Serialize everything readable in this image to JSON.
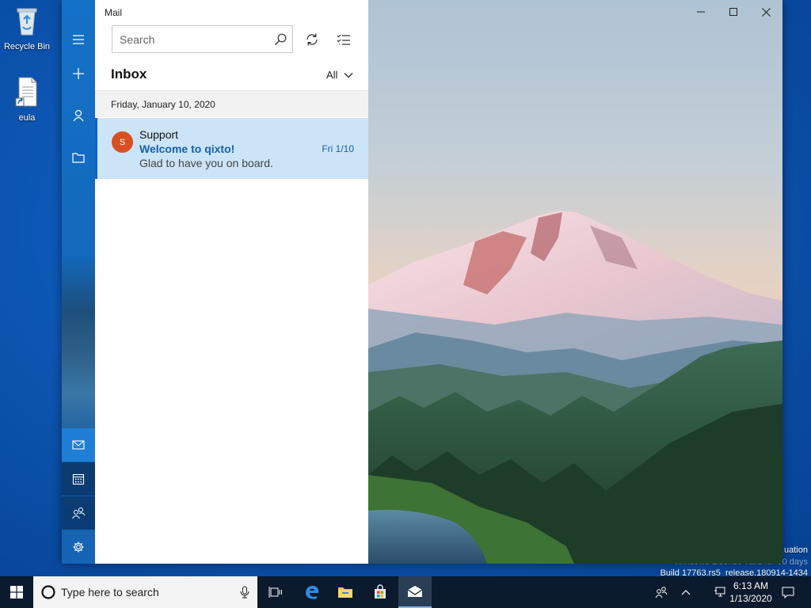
{
  "desktop": {
    "icons": [
      {
        "label": "Recycle Bin",
        "icon": "recycle-bin-icon"
      },
      {
        "label": "eula",
        "icon": "document-shortcut-icon"
      }
    ],
    "watermark": {
      "line1": "uation",
      "line2": "Windows License valid for 90 days",
      "line3": "Build 17763.rs5_release.180914-1434"
    }
  },
  "window": {
    "app_title": "Mail",
    "controls": [
      "minimize-icon",
      "maximize-icon",
      "close-icon"
    ]
  },
  "rail": {
    "top_items": [
      "hamburger-menu-icon",
      "plus-icon",
      "person-icon",
      "folder-icon"
    ],
    "bottom_items": [
      "mail-icon",
      "calendar-icon",
      "people-icon",
      "gear-icon"
    ]
  },
  "list": {
    "search": {
      "placeholder": "Search"
    },
    "folder_title": "Inbox",
    "filter_label": "All",
    "date_group": "Friday, January 10, 2020",
    "messages": [
      {
        "avatar_initial": "S",
        "sender": "Support",
        "subject": "Welcome to qixto!",
        "preview": "Glad to have you on board.",
        "date": "Fri 1/10"
      }
    ]
  },
  "taskbar": {
    "search_placeholder": "Type here to search",
    "clock_time": "6:13 AM",
    "clock_date": "1/13/2020",
    "colors": {
      "background": "#0b1a2c",
      "accent": "#1471c8"
    }
  }
}
